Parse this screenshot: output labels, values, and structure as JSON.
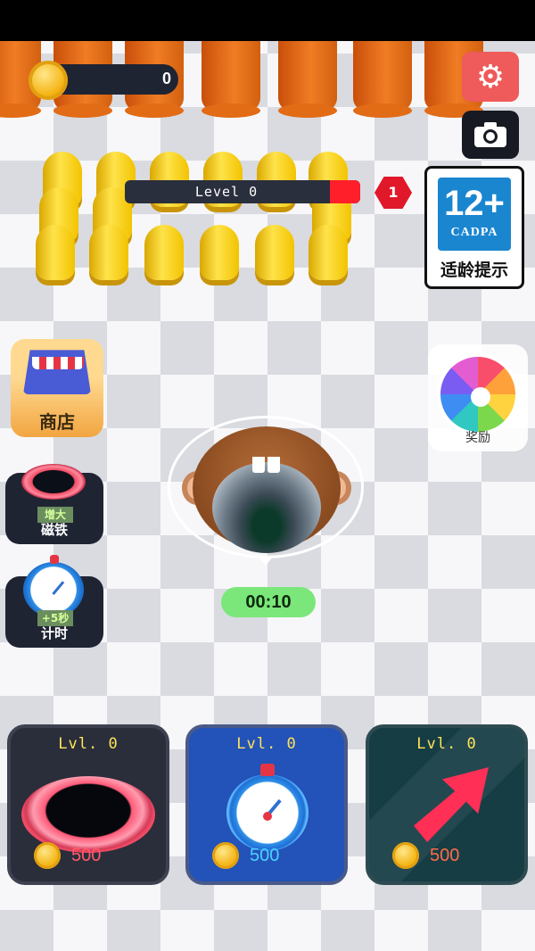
{
  "hud": {
    "coins": "0",
    "level_label": "Level 0",
    "level_progress": 0.1,
    "rank": "1"
  },
  "age_rating": {
    "rating": "12+",
    "org": "CADPA",
    "label": "适龄提示"
  },
  "side": {
    "shop_label": "商店",
    "magnet_tag": "增大",
    "magnet_label": "磁铁",
    "time_tag": "+5秒",
    "time_label": "计时",
    "reward_label": "奖励"
  },
  "timer": "00:10",
  "cards": [
    {
      "level": "Lvl. 0",
      "price": "500",
      "icon": "ring-icon"
    },
    {
      "level": "Lvl. 0",
      "price": "500",
      "icon": "stopwatch-icon"
    },
    {
      "level": "Lvl. 0",
      "price": "500",
      "icon": "speed-arrow-icon"
    }
  ],
  "colors": {
    "accent_red": "#ef5a5a",
    "timer_green": "#7be77a",
    "level_text": "#ffe45a"
  }
}
